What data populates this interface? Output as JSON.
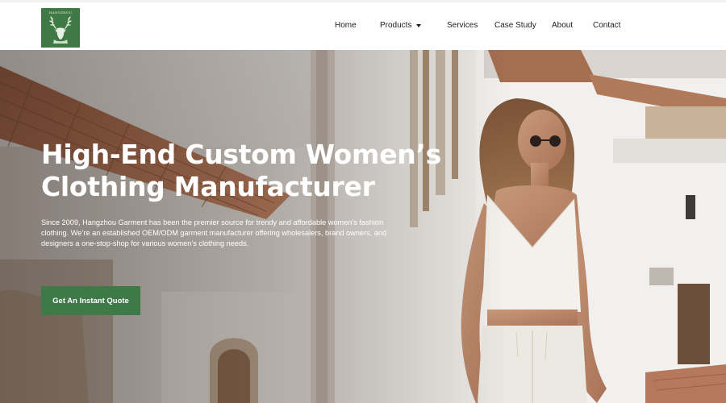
{
  "header": {
    "logo": {
      "text": "HANGZHOU",
      "icon": "stag-icon",
      "color": "#3f7a45"
    },
    "nav": {
      "home": "Home",
      "products": "Products",
      "services": "Services",
      "case_study": "Case Study",
      "about": "About",
      "contact": "Contact"
    }
  },
  "hero": {
    "title_line1": "High-End Custom Women’s",
    "title_line2": "Clothing Manufacturer",
    "description": "Since 2009, Hangzhou Garment has been the premier source for trendy and affordable women’s fashion clothing. We’re an established OEM/ODM garment manufacturer offering wholesalers, brand owners, and designers a one-stop-shop for various women’s clothing needs.",
    "cta_label": "Get An Instant Quote",
    "accent_color": "#3d7a47"
  }
}
